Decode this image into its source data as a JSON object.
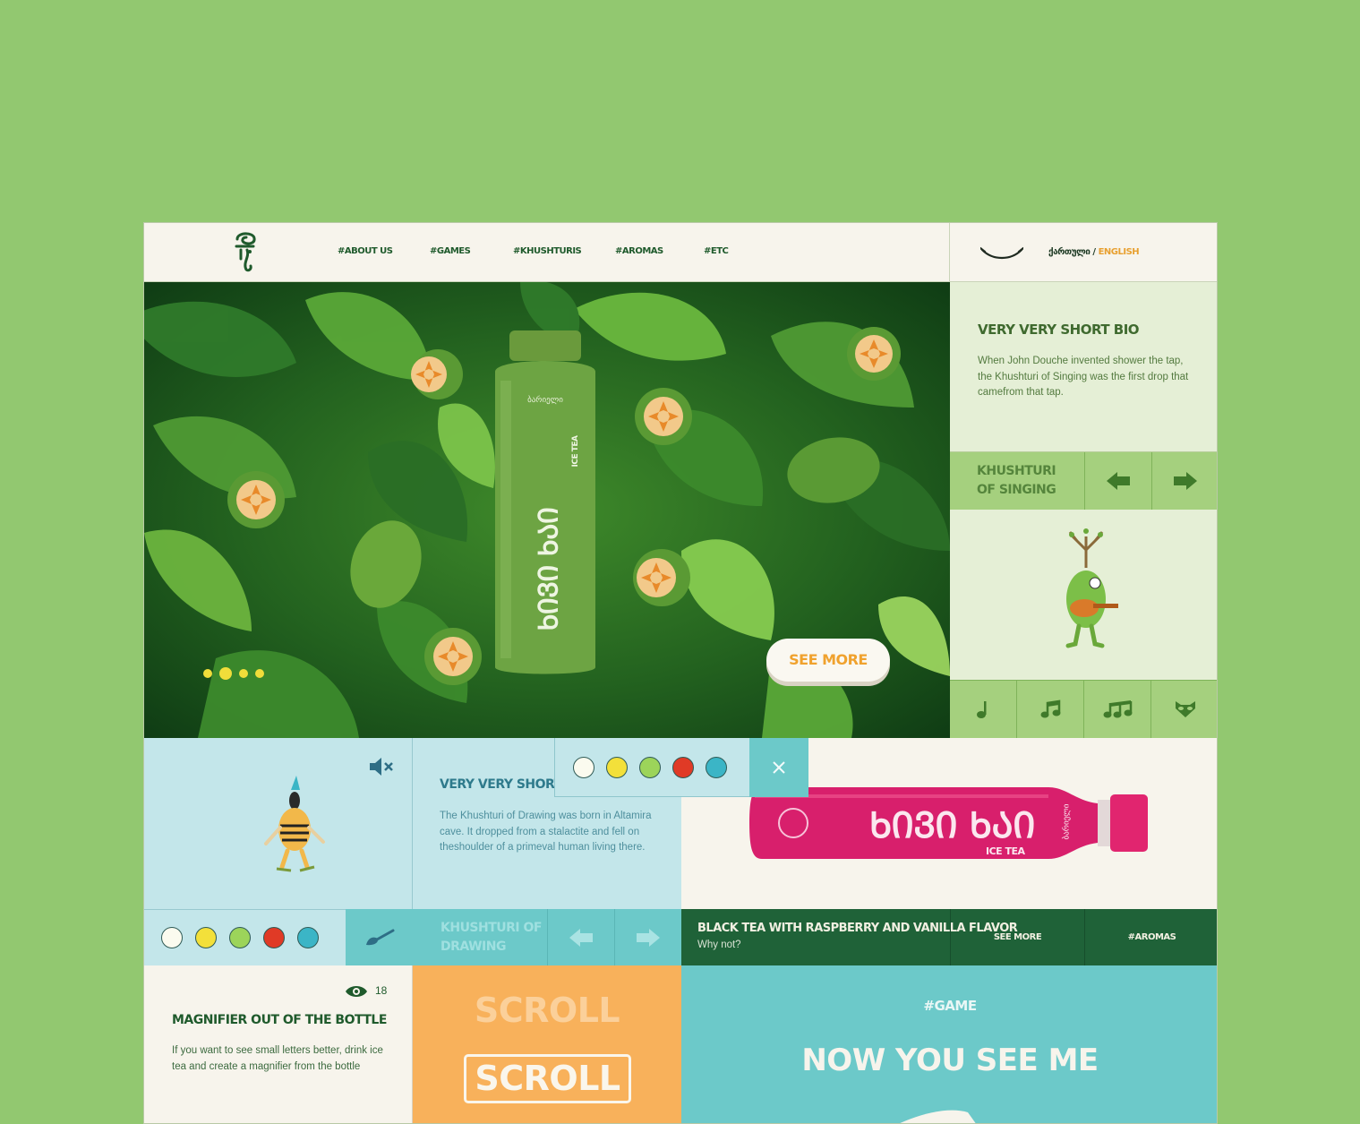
{
  "header": {
    "nav": [
      "#ABOUT US",
      "#GAMES",
      "#KHUSHTURIS",
      "#AROMAS",
      "#ETC"
    ],
    "lang_georgian": "ქართული",
    "lang_separator": "/",
    "lang_english": "ENGLISH"
  },
  "hero": {
    "bottle_brand": "ბარიელი",
    "bottle_name": "ᲮᲘᲕᲘ ᲮᲐᲘ",
    "bottle_type": "ICE TEA",
    "see_more": "SEE MORE",
    "slide_count": 4,
    "active_slide": 2
  },
  "singing": {
    "bio_title": "VERY VERY SHORT BIO",
    "bio_text": "When John Douche invented shower the tap, the Khushturi of Singing was the first drop that camefrom that tap.",
    "title_line1": "KHUSHTURI",
    "title_line2": "OF SINGING",
    "notes": [
      "quarter-note-icon",
      "eighth-notes-icon",
      "triplet-notes-icon",
      "raccoon-icon"
    ]
  },
  "drawing": {
    "bio_title": "VERY VERY SHORT BIO",
    "bio_text": "The Khushturi of Drawing was born in Altamira cave. It dropped from a stalactite and fell on theshoulder of a primeval human living there.",
    "title_line1": "KHUSHTURI OF",
    "title_line2": "DRAWING",
    "colors": [
      "#fbfbef",
      "#f3e03a",
      "#9cd45a",
      "#e03a26",
      "#3bb5c6"
    ]
  },
  "product": {
    "bottle_name": "ᲮᲘᲕᲘ ᲮᲐᲘ",
    "bottle_type": "ICE TEA",
    "bottle_brand": "ბარიელი",
    "title": "BLACK TEA WITH RASPBERRY AND VANILLA FLAVOR",
    "subtitle": "Why not?",
    "see_more": "SEE MORE",
    "aromas": "#AROMAS"
  },
  "magnifier": {
    "title": "MAGNIFIER OUT OF THE BOTTLE",
    "text": "If you want to see small letters better, drink ice tea and create a magnifier from the bottle",
    "views": "18"
  },
  "scroll": {
    "ghost": "SCROLL",
    "button": "SCROLL"
  },
  "game": {
    "tag": "#GAME",
    "title": "NOW YOU SEE ME"
  }
}
